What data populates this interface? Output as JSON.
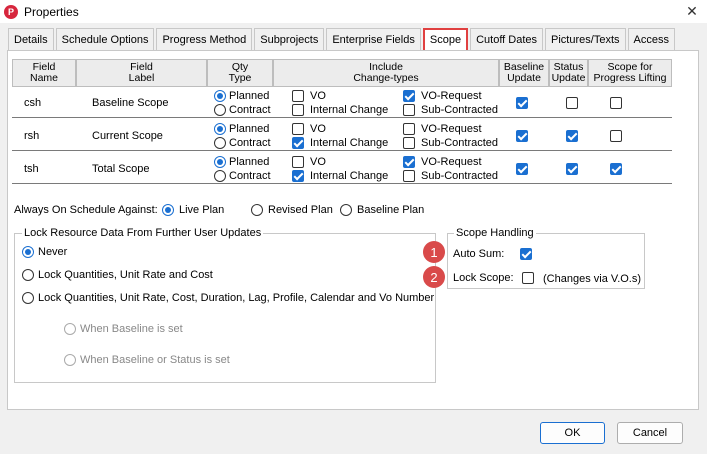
{
  "window": {
    "title": "Properties",
    "app_icon_glyph": "P"
  },
  "tabs": [
    "Details",
    "Schedule Options",
    "Progress Method",
    "Subprojects",
    "Enterprise Fields",
    "Scope",
    "Cutoff Dates",
    "Pictures/Texts",
    "Access"
  ],
  "active_tab": "Scope",
  "grid": {
    "headers": {
      "field_name": "Field\nName",
      "field_label": "Field\nLabel",
      "qty_type": "Qty\nType",
      "include": "Include\nChange-types",
      "baseline_update": "Baseline\nUpdate",
      "status_update": "Status\nUpdate",
      "scope_lifting": "Scope for\nProgress Lifting"
    },
    "option_labels": {
      "planned": "Planned",
      "contract": "Contract",
      "vo": "VO",
      "internal": "Internal Change",
      "vo_request": "VO-Request",
      "sub_contracted": "Sub-Contracted"
    },
    "rows": [
      {
        "name": "csh",
        "label": "Baseline Scope",
        "qty": "planned",
        "vo": false,
        "internal": false,
        "vo_request": true,
        "sub": false,
        "baseline": true,
        "status": false,
        "lifting": false
      },
      {
        "name": "rsh",
        "label": "Current Scope",
        "qty": "planned",
        "vo": false,
        "internal": true,
        "vo_request": false,
        "sub": false,
        "baseline": true,
        "status": true,
        "lifting": false
      },
      {
        "name": "tsh",
        "label": "Total  Scope",
        "qty": "planned",
        "vo": false,
        "internal": true,
        "vo_request": true,
        "sub": false,
        "baseline": true,
        "status": true,
        "lifting": true
      }
    ]
  },
  "schedule_against": {
    "label": "Always On Schedule Against:",
    "options": [
      "Live Plan",
      "Revised Plan",
      "Baseline Plan"
    ],
    "selected": 0
  },
  "lock_group": {
    "title": "Lock Resource Data From Further User Updates",
    "options": [
      "Never",
      "Lock Quantities, Unit Rate and Cost",
      "Lock Quantities, Unit Rate, Cost, Duration, Lag, Profile, Calendar and Vo Number"
    ],
    "selected": 0,
    "sub_options": [
      "When Baseline is set",
      "When Baseline or Status is set"
    ]
  },
  "scope_handling": {
    "title": "Scope Handling",
    "auto_sum_label": "Auto Sum:",
    "auto_sum": true,
    "lock_scope_label": "Lock Scope:",
    "lock_scope": false,
    "lock_scope_note": "(Changes via V.O.s)",
    "badges": [
      "1",
      "2"
    ]
  },
  "buttons": {
    "ok": "OK",
    "cancel": "Cancel"
  },
  "colors": {
    "accent": "#1a6fd1",
    "highlight": "#e04040",
    "badge": "#d94a4a"
  }
}
